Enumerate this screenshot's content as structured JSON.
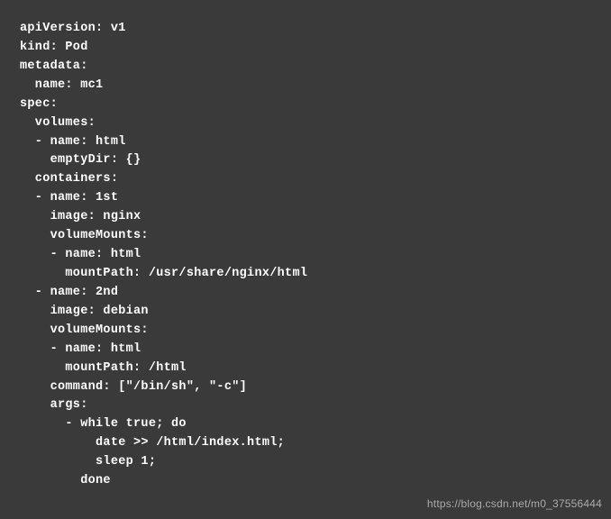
{
  "code": {
    "lines": [
      "apiVersion: v1",
      "kind: Pod",
      "metadata:",
      "  name: mc1",
      "spec:",
      "  volumes:",
      "  - name: html",
      "    emptyDir: {}",
      "  containers:",
      "  - name: 1st",
      "    image: nginx",
      "    volumeMounts:",
      "    - name: html",
      "      mountPath: /usr/share/nginx/html",
      "  - name: 2nd",
      "    image: debian",
      "    volumeMounts:",
      "    - name: html",
      "      mountPath: /html",
      "    command: [\"/bin/sh\", \"-c\"]",
      "    args:",
      "      - while true; do",
      "          date >> /html/index.html;",
      "          sleep 1;",
      "        done"
    ]
  },
  "watermark": "https://blog.csdn.net/m0_37556444"
}
